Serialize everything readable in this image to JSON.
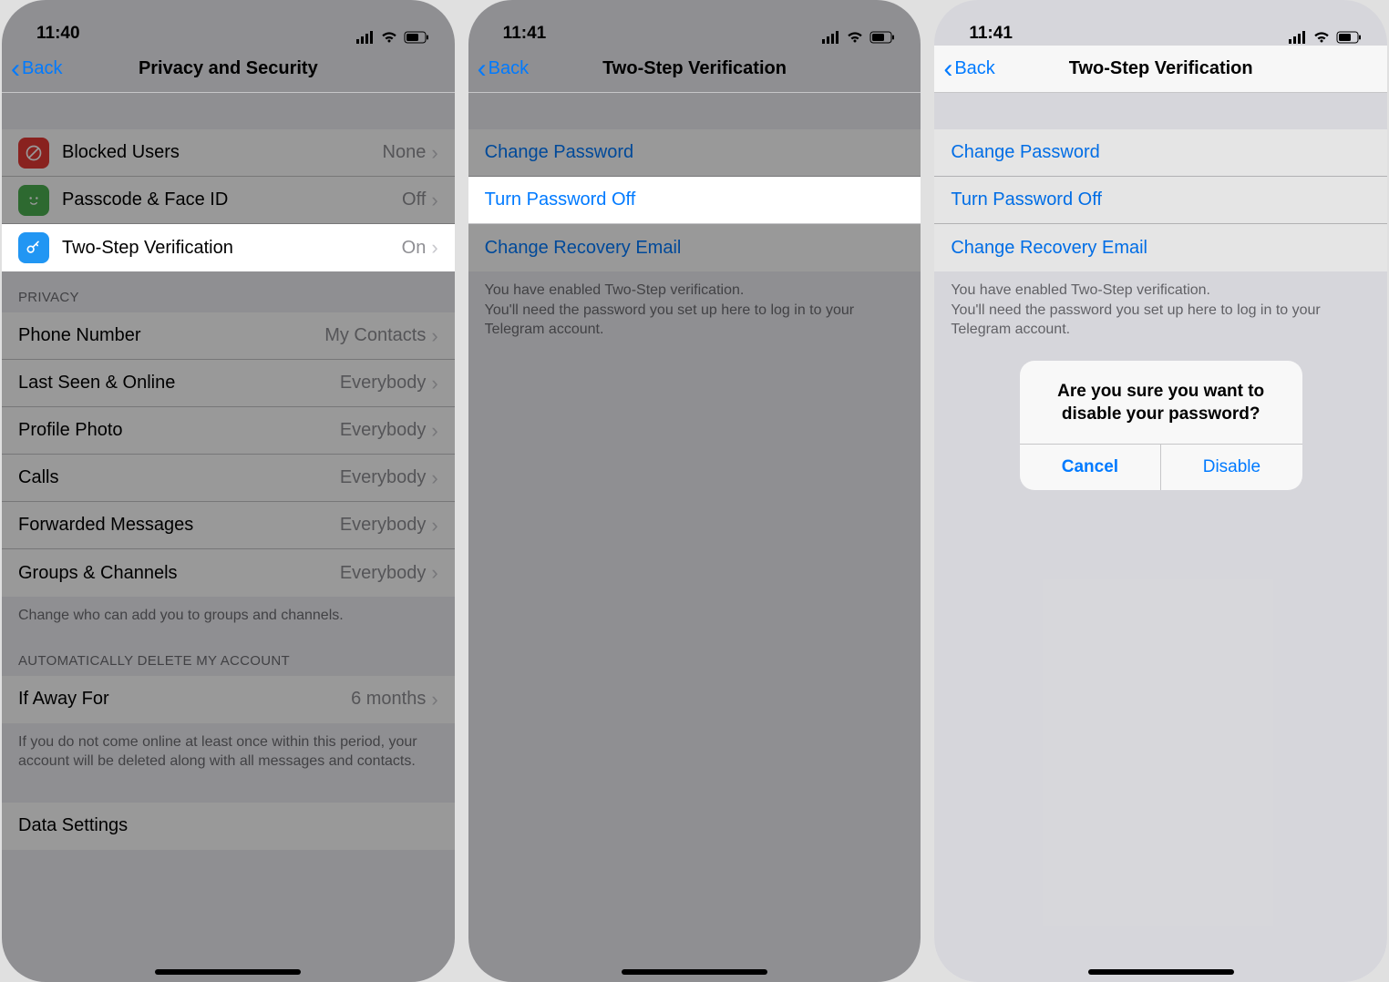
{
  "screen1": {
    "time": "11:40",
    "back": "Back",
    "title": "Privacy and Security",
    "security_items": [
      {
        "label": "Blocked Users",
        "value": "None"
      },
      {
        "label": "Passcode & Face ID",
        "value": "Off"
      },
      {
        "label": "Two-Step Verification",
        "value": "On"
      }
    ],
    "privacy_header": "PRIVACY",
    "privacy_items": [
      {
        "label": "Phone Number",
        "value": "My Contacts"
      },
      {
        "label": "Last Seen & Online",
        "value": "Everybody"
      },
      {
        "label": "Profile Photo",
        "value": "Everybody"
      },
      {
        "label": "Calls",
        "value": "Everybody"
      },
      {
        "label": "Forwarded Messages",
        "value": "Everybody"
      },
      {
        "label": "Groups & Channels",
        "value": "Everybody"
      }
    ],
    "privacy_footer": "Change who can add you to groups and channels.",
    "delete_header": "AUTOMATICALLY DELETE MY ACCOUNT",
    "delete_item": {
      "label": "If Away For",
      "value": "6 months"
    },
    "delete_footer": "If you do not come online at least once within this period, your account will be deleted along with all messages and contacts.",
    "data_settings": "Data Settings"
  },
  "screen2": {
    "time": "11:41",
    "back": "Back",
    "title": "Two-Step Verification",
    "items": [
      "Change Password",
      "Turn Password Off",
      "Change Recovery Email"
    ],
    "footer": "You have enabled Two-Step verification.\nYou'll need the password you set up here to log in to your Telegram account."
  },
  "screen3": {
    "time": "11:41",
    "back": "Back",
    "title": "Two-Step Verification",
    "items": [
      "Change Password",
      "Turn Password Off",
      "Change Recovery Email"
    ],
    "footer": "You have enabled Two-Step verification.\nYou'll need the password you set up here to log in to your Telegram account.",
    "alert": {
      "title": "Are you sure you want to disable your password?",
      "cancel": "Cancel",
      "confirm": "Disable"
    }
  }
}
